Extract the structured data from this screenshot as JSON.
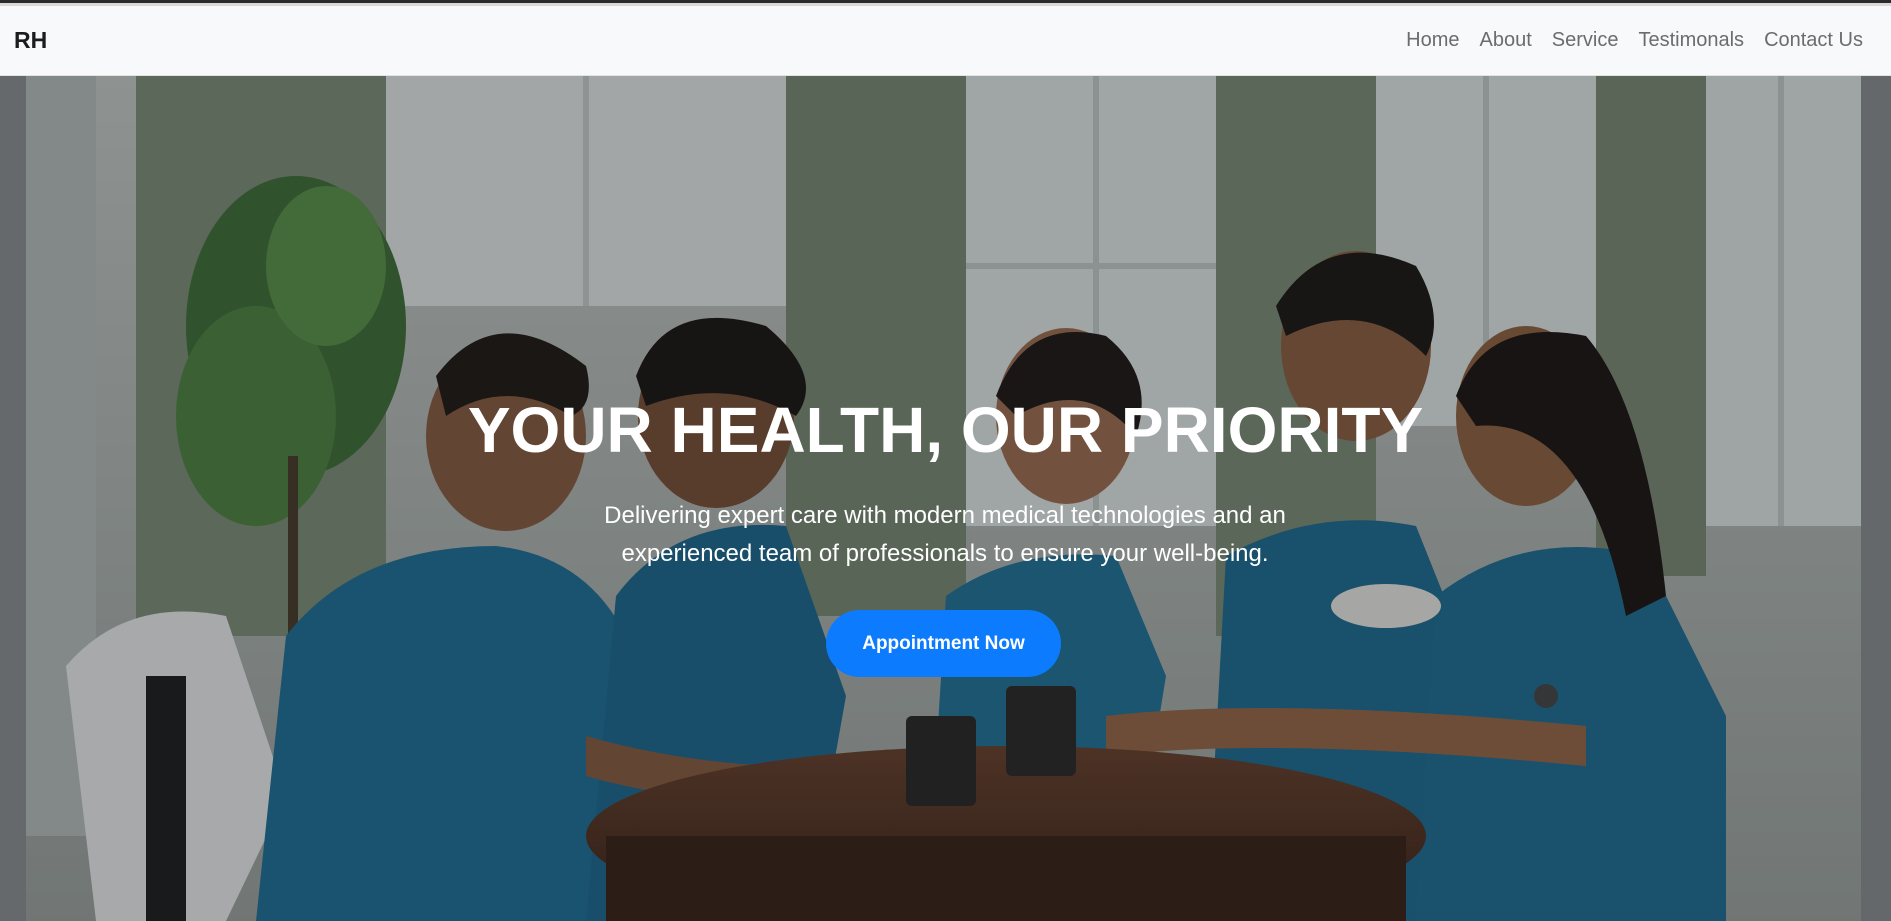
{
  "navbar": {
    "brand": "RH",
    "links": [
      "Home",
      "About",
      "Service",
      "Testimonals",
      "Contact Us"
    ]
  },
  "hero": {
    "title": "YOUR HEALTH, OUR PRIORITY",
    "subtitle": "Delivering expert care with modern medical technologies and an experienced team of professionals to ensure your well-being.",
    "cta_label": "Appointment Now"
  },
  "colors": {
    "navbar_bg": "#f8f9fa",
    "link_color": "#6c6c6c",
    "accent": "#0d7bfd",
    "scrub_blue": "#1e6f97"
  }
}
